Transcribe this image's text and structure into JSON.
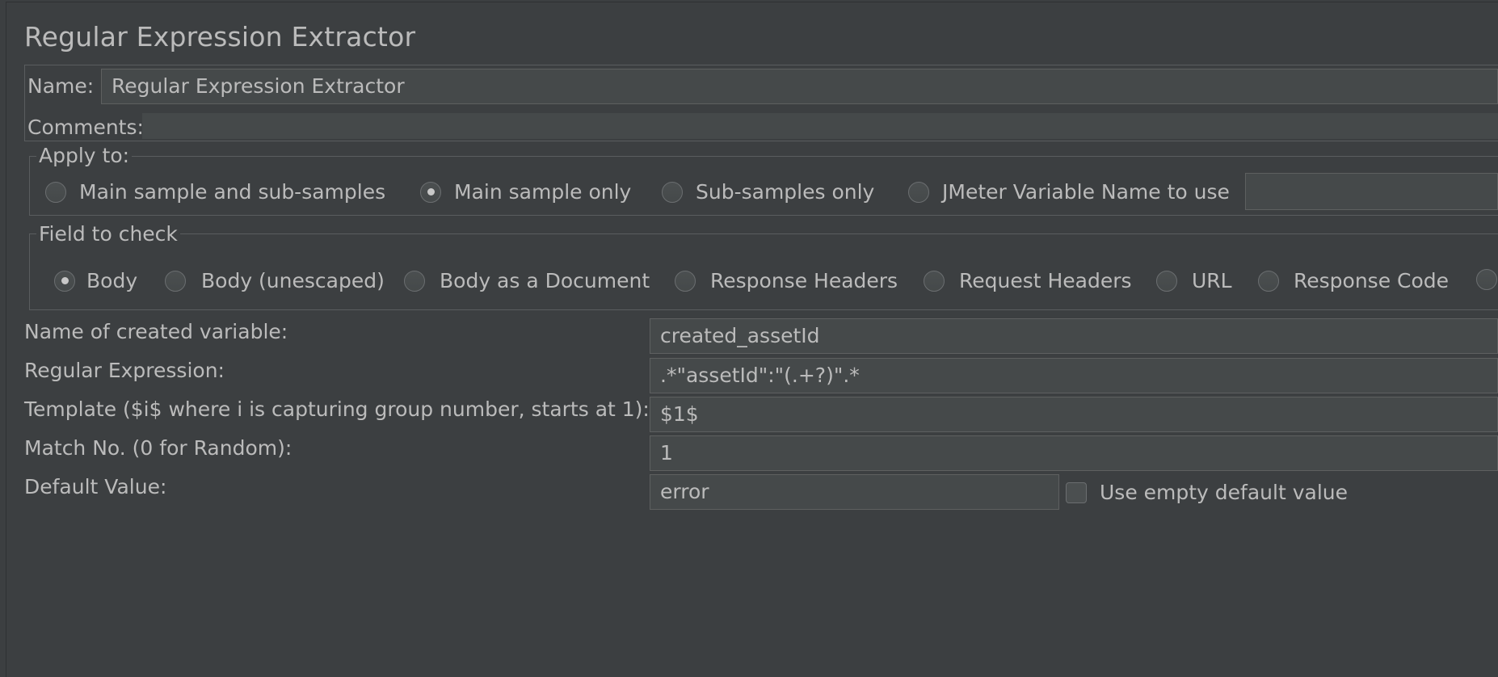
{
  "title": "Regular Expression Extractor",
  "name_label": "Name:",
  "name_value": "Regular Expression Extractor",
  "comments_label": "Comments:",
  "comments_value": "",
  "apply_to": {
    "legend": "Apply to:",
    "options": [
      {
        "label": "Main sample and sub-samples",
        "checked": false
      },
      {
        "label": "Main sample only",
        "checked": true
      },
      {
        "label": "Sub-samples only",
        "checked": false
      },
      {
        "label": "JMeter Variable Name to use",
        "checked": false
      }
    ],
    "variable_name_value": ""
  },
  "field_to_check": {
    "legend": "Field to check",
    "options": [
      {
        "label": "Body",
        "checked": true
      },
      {
        "label": "Body (unescaped)",
        "checked": false
      },
      {
        "label": "Body as a Document",
        "checked": false
      },
      {
        "label": "Response Headers",
        "checked": false
      },
      {
        "label": "Request Headers",
        "checked": false
      },
      {
        "label": "URL",
        "checked": false
      },
      {
        "label": "Response Code",
        "checked": false
      }
    ]
  },
  "fields": {
    "created_variable": {
      "label": "Name of created variable:",
      "value": "created_assetId"
    },
    "regex": {
      "label": "Regular Expression:",
      "value": ".*\"assetId\":\"(.+?)\".*"
    },
    "template": {
      "label": "Template ($i$ where i is capturing group number, starts at 1):",
      "value": "$1$"
    },
    "match_no": {
      "label": "Match No. (0 for Random):",
      "value": "1"
    },
    "default_value": {
      "label": "Default Value:",
      "value": "error"
    }
  },
  "use_empty_default": {
    "label": "Use empty default value",
    "checked": false
  }
}
